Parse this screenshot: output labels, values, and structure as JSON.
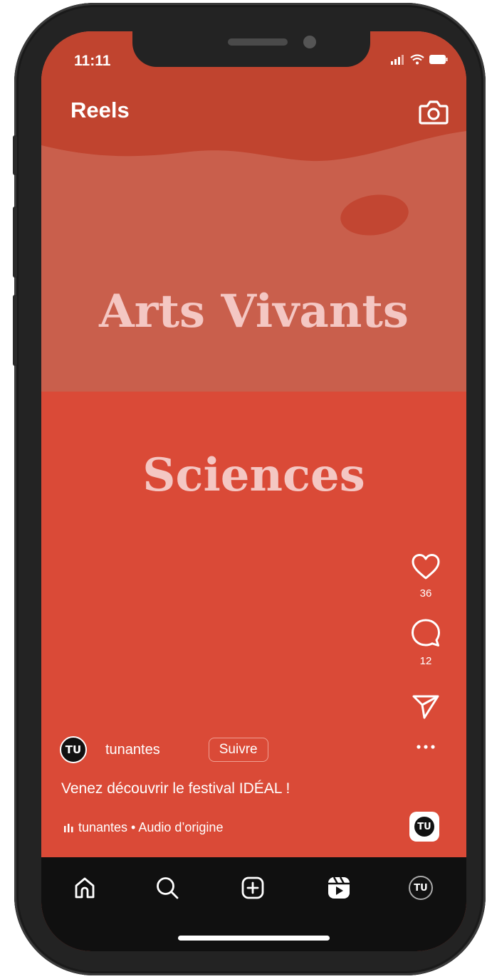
{
  "status_bar": {
    "time": "11:11"
  },
  "header": {
    "title": "Reels"
  },
  "reel": {
    "headline_1": "Arts Vivants",
    "headline_2": "Sciences"
  },
  "actions": {
    "likes": "36",
    "comments": "12"
  },
  "account": {
    "avatar_initials": "TU",
    "username": "tunantes",
    "follow_label": "Suivre"
  },
  "caption": "Venez découvrir le festival IDÉAL !",
  "audio": {
    "label": "tunantes • Audio d’origine"
  },
  "colors": {
    "accent": "#da4a37",
    "headline_text": "#f4c7c3",
    "navbar": "#101010"
  }
}
